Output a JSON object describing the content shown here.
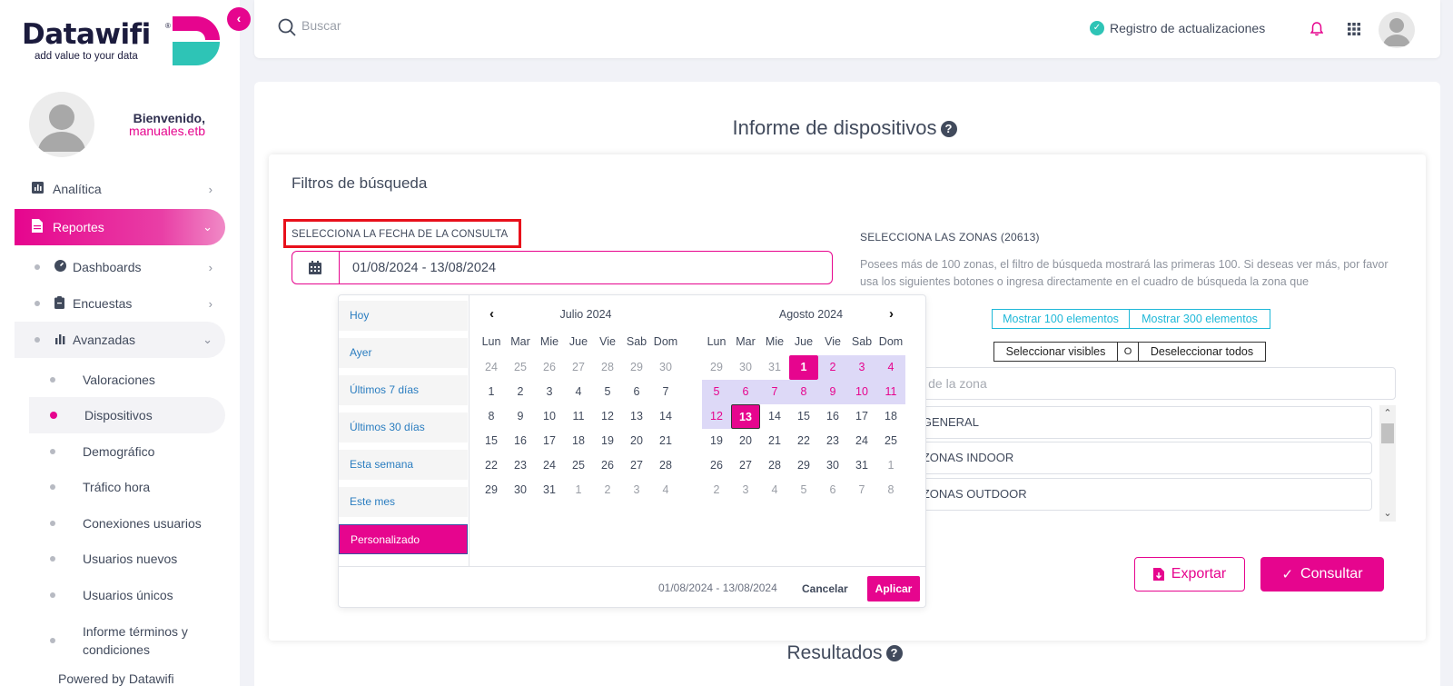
{
  "brand": {
    "name": "Datawifi",
    "registered": "®",
    "tagline": "add value to your data",
    "accent_color": "#e6058e",
    "secondary_color": "#2ec4b6"
  },
  "user": {
    "greeting": "Bienvenido,",
    "username": "manuales.etb"
  },
  "sidebar": {
    "items": [
      {
        "label": "Analítica",
        "icon": "bar-chart-icon"
      },
      {
        "label": "Reportes",
        "icon": "document-icon"
      }
    ],
    "subitems": [
      {
        "label": "Dashboards",
        "icon": "dashboard-icon"
      },
      {
        "label": "Encuestas",
        "icon": "clipboard-icon"
      },
      {
        "label": "Avanzadas",
        "icon": "bar-chart-icon"
      }
    ],
    "leaves": [
      {
        "label": "Valoraciones"
      },
      {
        "label": "Dispositivos"
      },
      {
        "label": "Demográfico"
      },
      {
        "label": "Tráfico hora"
      },
      {
        "label": "Conexiones usuarios"
      },
      {
        "label": "Usuarios nuevos"
      },
      {
        "label": "Usuarios únicos"
      },
      {
        "label": "Informe términos y condiciones"
      }
    ],
    "active_leaf": "Dispositivos",
    "powered_by": "Powered by Datawifi"
  },
  "topbar": {
    "search_placeholder": "Buscar",
    "updates_label": "Registro de actualizaciones"
  },
  "page": {
    "title": "Informe de dispositivos",
    "help_glyph": "?",
    "results_title": "Resultados"
  },
  "filters": {
    "title": "Filtros de búsqueda",
    "date_label": "SELECCIONA LA FECHA DE LA CONSULTA",
    "date_value": "01/08/2024 - 13/08/2024",
    "zones_label": "SELECCIONA LAS ZONAS (20613)",
    "zones_description": "Posees más de 100 zonas, el filtro de búsqueda mostrará las primeras 100. Si deseas ver más, por favor usa los siguientes botones o ingresa directamente en el cuadro de búsqueda la zona que",
    "show_100": "Mostrar 100 elementos",
    "show_300": "Mostrar 300 elementos",
    "select_visible": "Seleccionar visibles",
    "select_separator": "O",
    "deselect_all": "Deseleccionar todos",
    "zone_search_placeholder": "el nombre de la zona",
    "zones": [
      "g | GENERAL",
      "g | ZONAS INDOOR",
      "g | ZONAS OUTDOOR"
    ],
    "export_label": "Exportar",
    "query_label": "Consultar"
  },
  "datepicker": {
    "ranges": [
      "Hoy",
      "Ayer",
      "Últimos 7 días",
      "Últimos 30 días",
      "Esta semana",
      "Este mes",
      "Personalizado"
    ],
    "active_range": "Personalizado",
    "weekdays": [
      "Lun",
      "Mar",
      "Mie",
      "Jue",
      "Vie",
      "Sab",
      "Dom"
    ],
    "left": {
      "month": "Julio 2024",
      "weeks": [
        [
          "24",
          "25",
          "26",
          "27",
          "28",
          "29",
          "30"
        ],
        [
          "1",
          "2",
          "3",
          "4",
          "5",
          "6",
          "7"
        ],
        [
          "8",
          "9",
          "10",
          "11",
          "12",
          "13",
          "14"
        ],
        [
          "15",
          "16",
          "17",
          "18",
          "19",
          "20",
          "21"
        ],
        [
          "22",
          "23",
          "24",
          "25",
          "26",
          "27",
          "28"
        ],
        [
          "29",
          "30",
          "31",
          "1",
          "2",
          "3",
          "4"
        ]
      ]
    },
    "right": {
      "month": "Agosto 2024",
      "weeks": [
        [
          "29",
          "30",
          "31",
          "1",
          "2",
          "3",
          "4"
        ],
        [
          "5",
          "6",
          "7",
          "8",
          "9",
          "10",
          "11"
        ],
        [
          "12",
          "13",
          "14",
          "15",
          "16",
          "17",
          "18"
        ],
        [
          "19",
          "20",
          "21",
          "22",
          "23",
          "24",
          "25"
        ],
        [
          "26",
          "27",
          "28",
          "29",
          "30",
          "31",
          "1"
        ],
        [
          "2",
          "3",
          "4",
          "5",
          "6",
          "7",
          "8"
        ]
      ]
    },
    "range_start": "1",
    "range_end": "13",
    "footer_range": "01/08/2024 - 13/08/2024",
    "cancel_label": "Cancelar",
    "apply_label": "Aplicar"
  }
}
